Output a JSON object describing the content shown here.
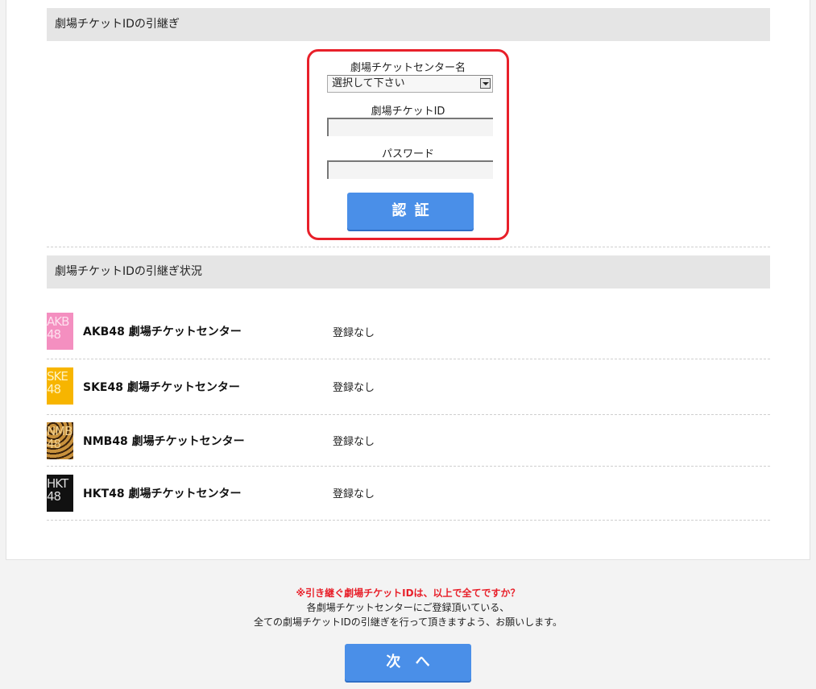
{
  "section1": {
    "title": "劇場チケットIDの引継ぎ"
  },
  "form": {
    "center_label": "劇場チケットセンター名",
    "center_select_value": "選択して下さい",
    "id_label": "劇場チケットID",
    "id_value": "",
    "password_label": "パスワード",
    "password_value": "",
    "auth_button": "認証"
  },
  "section2": {
    "title": "劇場チケットIDの引継ぎ状況",
    "rows": [
      {
        "logo_text": "AKB48",
        "name": "AKB48 劇場チケットセンター",
        "status": "登録なし",
        "logo_color": "#f48fc0"
      },
      {
        "logo_text": "SKE48",
        "name": "SKE48 劇場チケットセンター",
        "status": "登録なし",
        "logo_color": "#f7b500"
      },
      {
        "logo_text": "NMB48",
        "name": "NMB48 劇場チケットセンター",
        "status": "登録なし",
        "logo_color": "#b07a2c"
      },
      {
        "logo_text": "HKT48",
        "name": "HKT48 劇場チケットセンター",
        "status": "登録なし",
        "logo_color": "#111111"
      }
    ]
  },
  "notice": {
    "warning": "※引き継ぐ劇場チケットIDは、以上で全てですか？",
    "line1": "各劇場チケットセンターにご登録頂いている、",
    "line2": "全ての劇場チケットIDの引継ぎを行って頂きますよう、お願いします。"
  },
  "next_button": "次 へ",
  "colors": {
    "accent_button": "#4a8fe8",
    "highlight_border": "#e8202a",
    "warning_text": "#e8202a"
  }
}
